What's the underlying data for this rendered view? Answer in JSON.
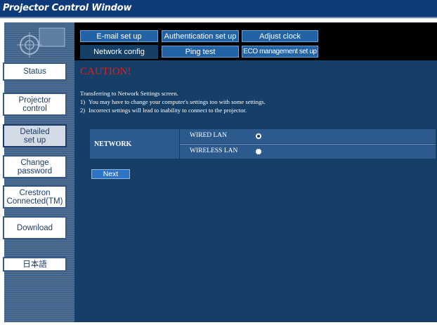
{
  "window": {
    "title": "Projector Control Window"
  },
  "sidebar": {
    "items": [
      {
        "label": "Status"
      },
      {
        "label": "Projector\ncontrol"
      },
      {
        "label": "Detailed\nset up"
      },
      {
        "label": "Change\npassword"
      },
      {
        "label": "Crestron\nConnected(TM)"
      },
      {
        "label": "Download"
      },
      {
        "label": "日本語"
      }
    ],
    "active_index": 2
  },
  "tabs": {
    "row1": [
      {
        "label": "E-mail set up"
      },
      {
        "label": "Authentication set up"
      },
      {
        "label": "Adjust clock"
      }
    ],
    "row2": [
      {
        "label": "Network config"
      },
      {
        "label": "Ping test"
      },
      {
        "label": "ECO management set up"
      }
    ],
    "selected": "Network config"
  },
  "content": {
    "caution": "CAUTION!",
    "lines": [
      {
        "num": "",
        "text": "Transferring to Network Settings screen."
      },
      {
        "num": "1)",
        "text": "You may have to change your computer's settings too with some settings."
      },
      {
        "num": "2)",
        "text": "Incorrect settings will lead to inability to connect to the projector."
      }
    ],
    "network": {
      "label": "NETWORK",
      "options": [
        {
          "label": "WIRED LAN",
          "checked": true
        },
        {
          "label": "WIRELESS LAN",
          "checked": false
        }
      ]
    },
    "next_label": "Next"
  },
  "colors": {
    "title_bar": "#0d3a78",
    "content_bg": "#153f67",
    "tab_bg": "#2163a5",
    "caution": "#e81b1b",
    "table_bg": "#2d5a8c",
    "next_button": "#2d74c4"
  }
}
